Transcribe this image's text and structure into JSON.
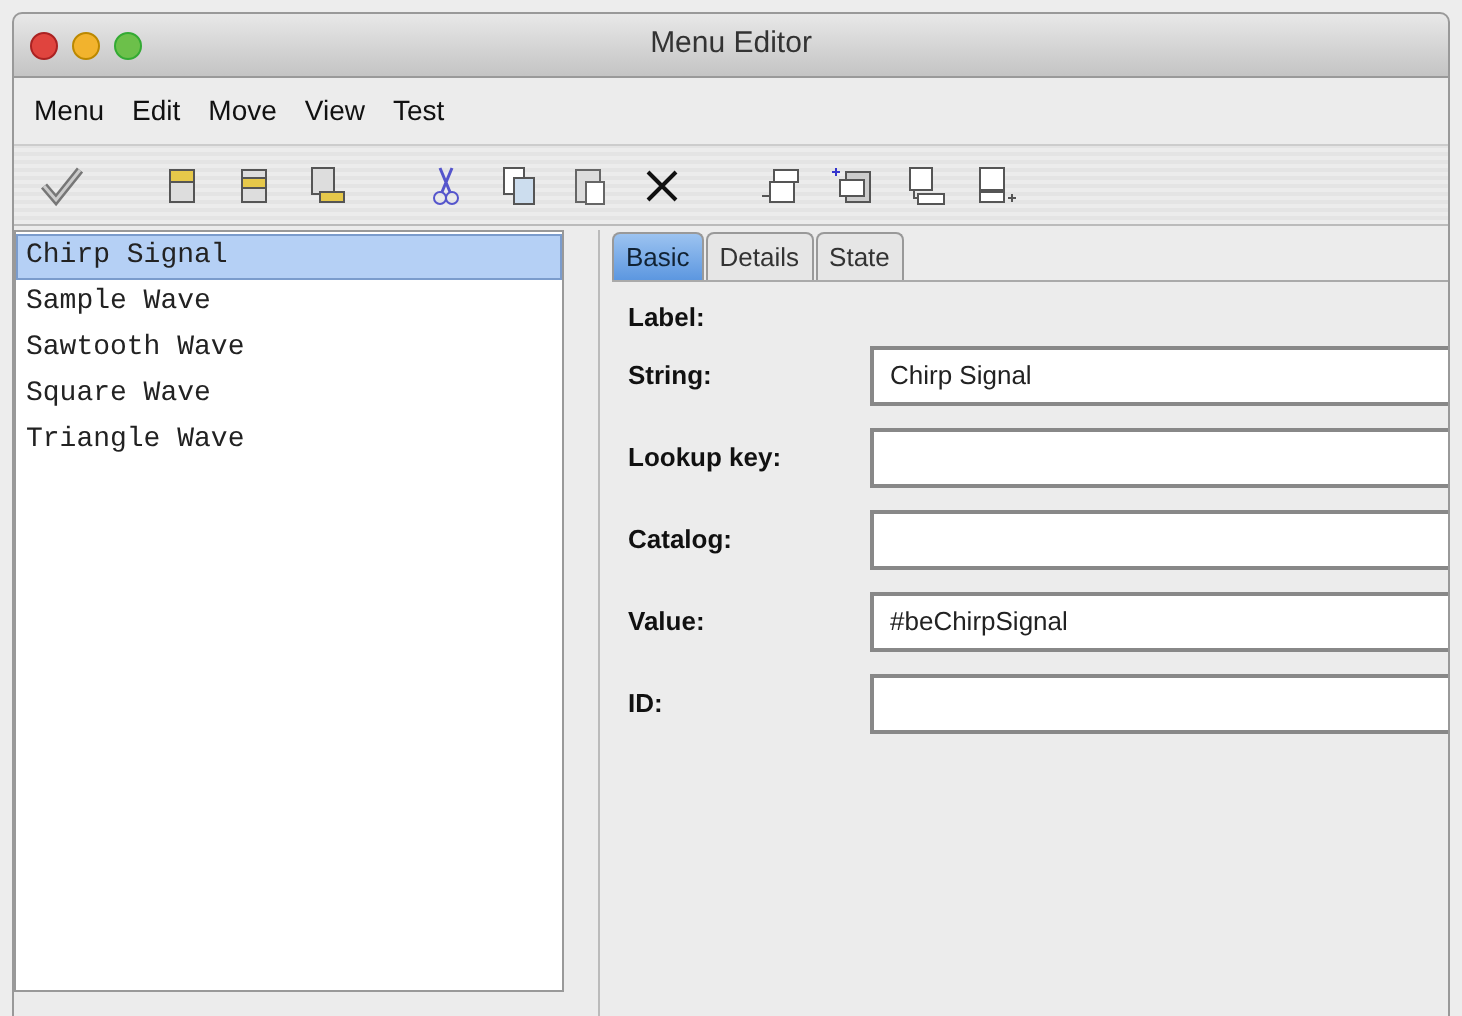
{
  "window": {
    "title": "Menu Editor"
  },
  "menu_bar": [
    "Menu",
    "Edit",
    "Move",
    "View",
    "Test"
  ],
  "toolbar": [
    {
      "kind": "check"
    },
    {
      "kind": "gap"
    },
    {
      "kind": "stack-up"
    },
    {
      "kind": "stack-down"
    },
    {
      "kind": "stack-side"
    },
    {
      "kind": "gap"
    },
    {
      "kind": "cut"
    },
    {
      "kind": "copy"
    },
    {
      "kind": "paste"
    },
    {
      "kind": "delete"
    },
    {
      "kind": "gap"
    },
    {
      "kind": "add-before"
    },
    {
      "kind": "add-child"
    },
    {
      "kind": "add-below"
    },
    {
      "kind": "add-after"
    }
  ],
  "list": [
    {
      "label": "Chirp Signal",
      "selected": true
    },
    {
      "label": "Sample Wave",
      "selected": false
    },
    {
      "label": "Sawtooth Wave",
      "selected": false
    },
    {
      "label": "Square Wave",
      "selected": false
    },
    {
      "label": "Triangle Wave",
      "selected": false
    }
  ],
  "tabs": [
    {
      "label": "Basic",
      "selected": true
    },
    {
      "label": "Details",
      "selected": false
    },
    {
      "label": "State",
      "selected": false
    }
  ],
  "form": [
    {
      "kind": "heading",
      "label": "Label:"
    },
    {
      "kind": "field",
      "label": "String:",
      "value": "Chirp Signal"
    },
    {
      "kind": "field",
      "label": "Lookup key:"
    },
    {
      "kind": "field",
      "label": "Catalog:"
    },
    {
      "kind": "field",
      "label": "Value:",
      "value": "#beChirpSignal"
    },
    {
      "kind": "field",
      "label": "ID:"
    }
  ]
}
